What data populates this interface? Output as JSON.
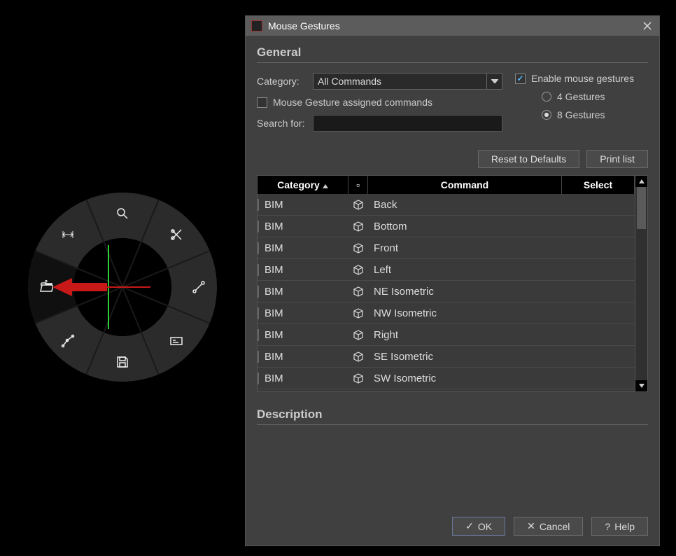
{
  "dialog": {
    "title": "Mouse Gestures",
    "section_general": "General",
    "category_label": "Category:",
    "category_value": "All Commands",
    "assigned_only_label": "Mouse Gesture assigned commands",
    "assigned_only_checked": false,
    "search_label": "Search for:",
    "search_value": "",
    "enable_label": "Enable mouse gestures",
    "enable_checked": true,
    "radio_4_label": "4 Gestures",
    "radio_8_label": "8 Gestures",
    "radio_selected": "8",
    "reset_label": "Reset to Defaults",
    "print_label": "Print list",
    "columns": {
      "category": "Category",
      "icon": "▫",
      "command": "Command",
      "select": "Select"
    },
    "rows": [
      {
        "category": "BIM",
        "command": "Back",
        "icon": "cube-back"
      },
      {
        "category": "BIM",
        "command": "Bottom",
        "icon": "cube-bottom"
      },
      {
        "category": "BIM",
        "command": "Front",
        "icon": "cube-front"
      },
      {
        "category": "BIM",
        "command": "Left",
        "icon": "cube-left"
      },
      {
        "category": "BIM",
        "command": "NE Isometric",
        "icon": "cube-iso"
      },
      {
        "category": "BIM",
        "command": "NW Isometric",
        "icon": "cube-iso"
      },
      {
        "category": "BIM",
        "command": "Right",
        "icon": "cube-right"
      },
      {
        "category": "BIM",
        "command": "SE Isometric",
        "icon": "cube-iso"
      },
      {
        "category": "BIM",
        "command": "SW Isometric",
        "icon": "cube-iso"
      }
    ],
    "section_description": "Description",
    "ok_label": "OK",
    "cancel_label": "Cancel",
    "help_label": "Help"
  },
  "radial": {
    "segments": [
      {
        "pos": "n",
        "icon": "zoom"
      },
      {
        "pos": "ne",
        "icon": "snip"
      },
      {
        "pos": "e",
        "icon": "line"
      },
      {
        "pos": "se",
        "icon": "card"
      },
      {
        "pos": "s",
        "icon": "save"
      },
      {
        "pos": "sw",
        "icon": "pline"
      },
      {
        "pos": "w",
        "icon": "open",
        "active": true
      },
      {
        "pos": "nw",
        "icon": "dim"
      }
    ]
  }
}
